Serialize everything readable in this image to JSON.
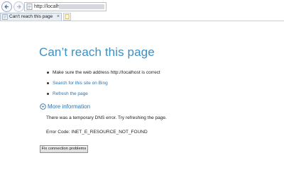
{
  "browser": {
    "address_url": "http://localhost",
    "tab_title": "Can't reach this page",
    "tab_close_glyph": "×",
    "icons": {
      "back": "back-arrow-icon",
      "forward": "forward-arrow-icon",
      "page": "ie-page-icon",
      "new_tab": "new-tab-icon"
    }
  },
  "error_page": {
    "title": "Can’t reach this page",
    "suggestions": [
      {
        "text": "Make sure the web address http://localhost is correct",
        "is_link": false
      },
      {
        "text": "Search for this site on Bing",
        "is_link": true
      },
      {
        "text": "Refresh the page",
        "is_link": true
      }
    ],
    "more_info_label": "More information",
    "more_info_icon": "expand-circle-icon",
    "dns_message": "There was a temporary DNS error. Try refreshing the page.",
    "error_code": "Error Code: INET_E_RESOURCE_NOT_FOUND",
    "fix_button_label": "Fix connection problems"
  },
  "colors": {
    "title": "#3e8fbf",
    "link": "#2b73b0",
    "text": "#222222"
  }
}
